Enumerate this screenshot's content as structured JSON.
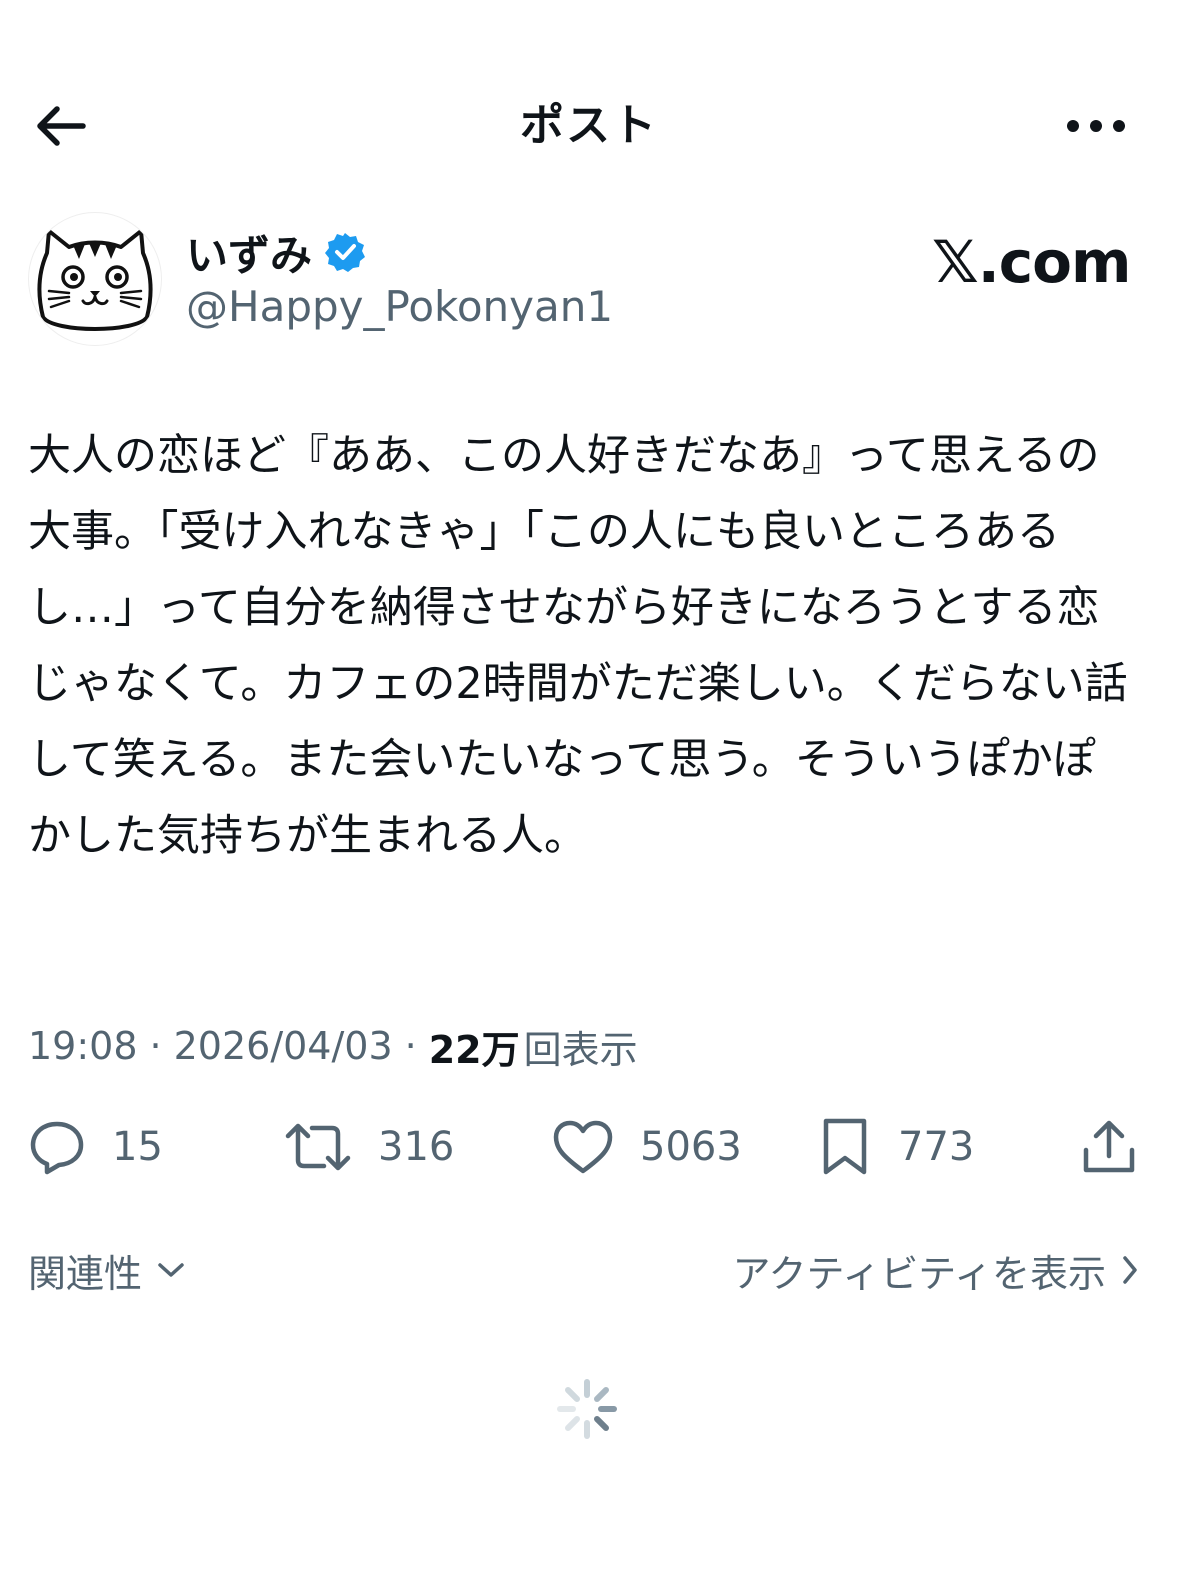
{
  "header": {
    "title": "ポスト",
    "back_icon": "arrow-left-icon",
    "more_icon": "more-horizontal-icon"
  },
  "author": {
    "name": "いずみ",
    "verified": true,
    "verified_color": "#1d9bf0",
    "handle": "@Happy_Pokonyan1",
    "avatar_icon": "cat-face-avatar"
  },
  "watermark": {
    "text": "𝕏.com"
  },
  "post": {
    "text": "大人の恋ほど『ああ、この人好きだなあ』って思えるの大事。「受け入れなきゃ」「この人にも良いところあるし…」って自分を納得させながら好きになろうとする恋じゃなくて。カフェの2時間がただ楽しい。くだらない話して笑える。また会いたいなって思う。そういうぽかぽかした気持ちが生まれる人。"
  },
  "meta": {
    "time": "19:08",
    "date": "2026/04/03",
    "views_count": "22万",
    "views_label": "回表示",
    "separator": "·"
  },
  "actions": {
    "replies": "15",
    "reposts": "316",
    "likes": "5063",
    "bookmarks": "773"
  },
  "sort": {
    "relevance_label": "関連性",
    "activity_label": "アクティビティを表示"
  },
  "colors": {
    "text_primary": "#0f1419",
    "text_secondary": "#536471",
    "accent": "#1d9bf0"
  }
}
